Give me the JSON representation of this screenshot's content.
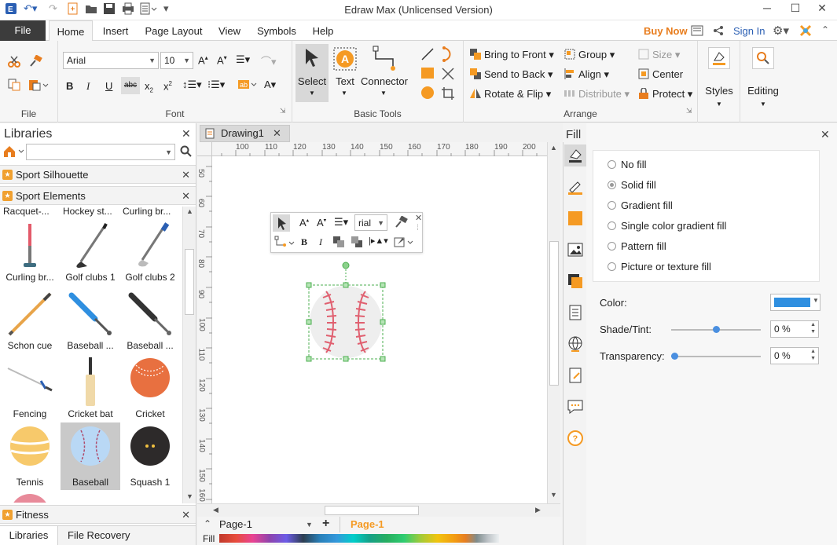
{
  "window": {
    "title": "Edraw Max (Unlicensed Version)",
    "minimize": "─",
    "maximize": "☐",
    "close": "✕"
  },
  "menu": {
    "file": "File",
    "tabs": [
      "Home",
      "Insert",
      "Page Layout",
      "View",
      "Symbols",
      "Help"
    ],
    "active_tab": "Home",
    "buy_now": "Buy Now",
    "sign_in": "Sign In"
  },
  "ribbon": {
    "file_group": "File",
    "font_group": "Font",
    "font_name": "Arial",
    "font_size": "10",
    "basic_tools_group": "Basic Tools",
    "select": "Select",
    "text": "Text",
    "connector": "Connector",
    "arrange_group": "Arrange",
    "bring_to_front": "Bring to Front",
    "send_to_back": "Send to Back",
    "rotate_flip": "Rotate & Flip",
    "group": "Group",
    "align": "Align",
    "distribute": "Distribute",
    "size": "Size",
    "center": "Center",
    "protect": "Protect",
    "styles": "Styles",
    "editing": "Editing"
  },
  "libraries": {
    "title": "Libraries",
    "search_placeholder": "",
    "sections": [
      "Sport Silhouette",
      "Sport Elements",
      "Fitness"
    ],
    "top_labels": [
      "Racquet-...",
      "Hockey st...",
      "Curling br..."
    ],
    "shapes": [
      {
        "label": "Curling br..."
      },
      {
        "label": "Golf clubs 1"
      },
      {
        "label": "Golf clubs 2"
      },
      {
        "label": "Schon cue"
      },
      {
        "label": "Baseball ..."
      },
      {
        "label": "Baseball ..."
      },
      {
        "label": "Fencing"
      },
      {
        "label": "Cricket bat"
      },
      {
        "label": "Cricket"
      },
      {
        "label": "Tennis"
      },
      {
        "label": "Baseball"
      },
      {
        "label": "Squash 1"
      }
    ],
    "bottom_tabs": [
      "Libraries",
      "File Recovery"
    ]
  },
  "document": {
    "tab_name": "Drawing1",
    "ruler_h": [
      "100",
      "110",
      "120",
      "130",
      "140",
      "150",
      "160",
      "170",
      "180",
      "190",
      "200"
    ],
    "ruler_v": [
      "50",
      "60",
      "70",
      "80",
      "90",
      "100",
      "110",
      "120",
      "130",
      "140",
      "150",
      "160"
    ],
    "mini_font": "rial",
    "page_select": "Page-1",
    "page_tab": "Page-1",
    "fill_label": "Fill"
  },
  "fill_panel": {
    "title": "Fill",
    "options": [
      "No fill",
      "Solid fill",
      "Gradient fill",
      "Single color gradient fill",
      "Pattern fill",
      "Picture or texture fill"
    ],
    "selected": "Solid fill",
    "color_label": "Color:",
    "color_value": "#2f8fe0",
    "shade_label": "Shade/Tint:",
    "shade_value": "0 %",
    "transparency_label": "Transparency:",
    "transparency_value": "0 %"
  },
  "colors": {
    "accent_orange": "#f59a23",
    "buy_orange": "#e87d1e",
    "link_blue": "#2b5fb3",
    "selection_green": "#4caf50"
  }
}
